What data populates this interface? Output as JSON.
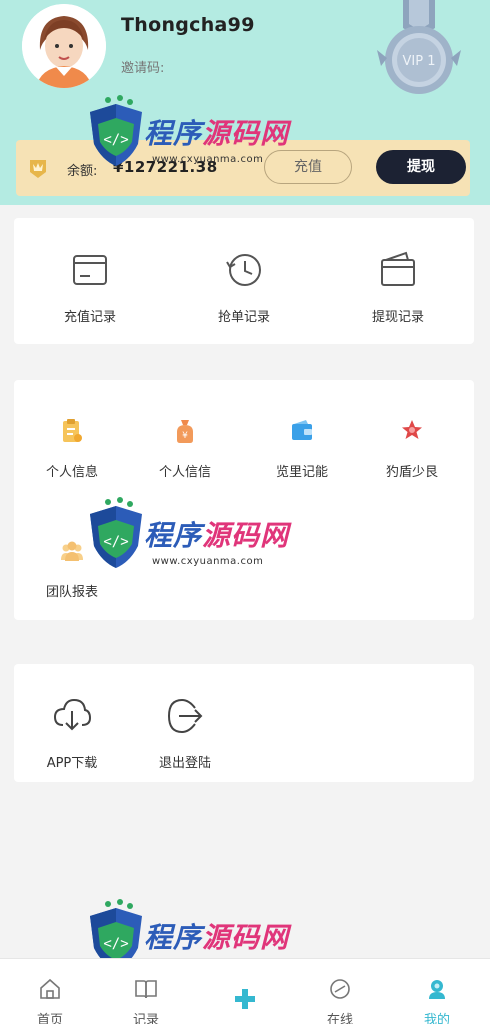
{
  "header": {
    "username": "Thongcha99",
    "invite_label": "邀请码:",
    "vip_label": "VIP 1"
  },
  "balance": {
    "label": "余额:",
    "value": "¥127221.38",
    "recharge_label": "充值",
    "withdraw_label": "提现"
  },
  "records": [
    {
      "label": "充值记录",
      "icon": "card-icon"
    },
    {
      "label": "抢单记录",
      "icon": "history-clock-icon"
    },
    {
      "label": "提现记录",
      "icon": "wallet-icon"
    }
  ],
  "menu": [
    {
      "label": "个人信息",
      "icon": "clipboard-icon",
      "color": "#f0b040"
    },
    {
      "label": "个人信信",
      "icon": "money-bag-icon",
      "color": "#f08a4b"
    },
    {
      "label": "览里记能",
      "icon": "wallet-blue-icon",
      "color": "#3aa0e8"
    },
    {
      "label": "犳盾少艮",
      "icon": "star-badge-icon",
      "color": "#e04848"
    },
    {
      "label": "团队报表",
      "icon": "team-icon",
      "color": "#f4c070"
    }
  ],
  "actions": [
    {
      "label": "APP下载",
      "icon": "cloud-download-icon"
    },
    {
      "label": "退出登陆",
      "icon": "logout-icon"
    }
  ],
  "watermark": {
    "title_a": "程序",
    "title_b": "源码网",
    "url": "www.cxyuanma.com"
  },
  "nav": [
    {
      "label": "首页",
      "icon": "home-icon"
    },
    {
      "label": "记录",
      "icon": "book-icon"
    },
    {
      "label": "",
      "icon": "plus-icon"
    },
    {
      "label": "在线",
      "icon": "chat-icon"
    },
    {
      "label": "我的",
      "icon": "user-icon",
      "active": true
    }
  ]
}
